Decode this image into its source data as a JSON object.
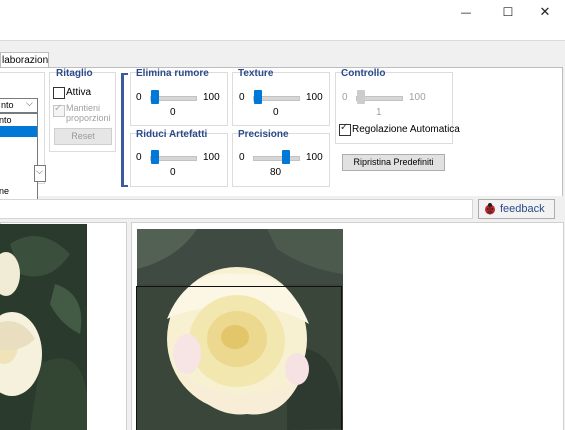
{
  "window": {
    "minimize_icon": "minimize-icon",
    "maximize_icon": "maximize-icon",
    "close_icon": "close-icon",
    "minimize_glyph": "—",
    "maximize_glyph": "☐",
    "close_glyph": "✕"
  },
  "tab": {
    "label": "laborazione"
  },
  "dropdown": {
    "value": "nto",
    "items": [
      "nto",
      "",
      "",
      "",
      "",
      "ne"
    ],
    "selected_index": 1,
    "second_combo_value": ""
  },
  "ritaglio": {
    "title": "Ritaglio",
    "attiva_label": "Attiva",
    "mantieni_label_1": "Mantieni",
    "mantieni_label_2": "proporzioni",
    "reset_label": "Reset"
  },
  "elimina_rumore": {
    "title": "Elimina rumore",
    "min": "0",
    "max": "100",
    "value": 0
  },
  "texture": {
    "title": "Texture",
    "min": "0",
    "max": "100",
    "value": 0
  },
  "riduci_artefatti": {
    "title": "Riduci Artefatti",
    "min": "0",
    "max": "100",
    "value": 0
  },
  "precisione": {
    "title": "Precisione",
    "min": "0",
    "max": "100",
    "value": 80
  },
  "controllo": {
    "title": "Controllo",
    "min": "0",
    "max": "100",
    "value": 1,
    "auto_label": "Regolazione Automatica",
    "ripristina_label": "Ripristina Predefiniti"
  },
  "feedback": {
    "label": "feedback",
    "icon": "ladybug-icon"
  },
  "colors": {
    "accent": "#0078d7",
    "group_title": "#2b4a8a",
    "bracket": "#3b5aa0"
  }
}
